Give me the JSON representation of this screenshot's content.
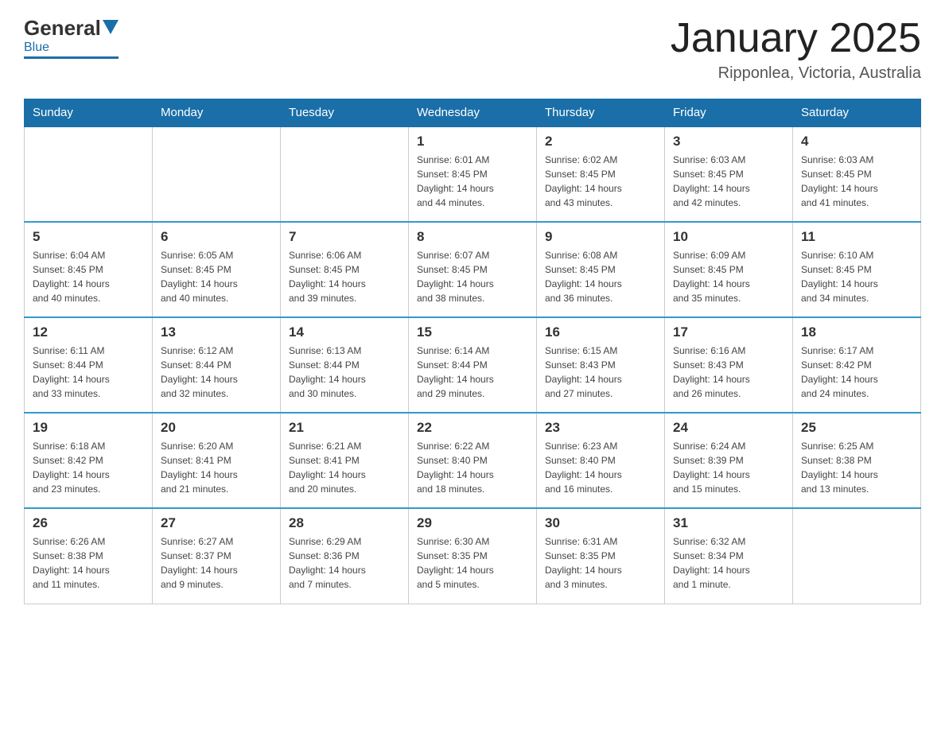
{
  "header": {
    "logo_text_general": "General",
    "logo_text_blue": "Blue",
    "calendar_title": "January 2025",
    "calendar_subtitle": "Ripponlea, Victoria, Australia"
  },
  "weekdays": [
    "Sunday",
    "Monday",
    "Tuesday",
    "Wednesday",
    "Thursday",
    "Friday",
    "Saturday"
  ],
  "weeks": [
    [
      {
        "day": "",
        "info": ""
      },
      {
        "day": "",
        "info": ""
      },
      {
        "day": "",
        "info": ""
      },
      {
        "day": "1",
        "info": "Sunrise: 6:01 AM\nSunset: 8:45 PM\nDaylight: 14 hours\nand 44 minutes."
      },
      {
        "day": "2",
        "info": "Sunrise: 6:02 AM\nSunset: 8:45 PM\nDaylight: 14 hours\nand 43 minutes."
      },
      {
        "day": "3",
        "info": "Sunrise: 6:03 AM\nSunset: 8:45 PM\nDaylight: 14 hours\nand 42 minutes."
      },
      {
        "day": "4",
        "info": "Sunrise: 6:03 AM\nSunset: 8:45 PM\nDaylight: 14 hours\nand 41 minutes."
      }
    ],
    [
      {
        "day": "5",
        "info": "Sunrise: 6:04 AM\nSunset: 8:45 PM\nDaylight: 14 hours\nand 40 minutes."
      },
      {
        "day": "6",
        "info": "Sunrise: 6:05 AM\nSunset: 8:45 PM\nDaylight: 14 hours\nand 40 minutes."
      },
      {
        "day": "7",
        "info": "Sunrise: 6:06 AM\nSunset: 8:45 PM\nDaylight: 14 hours\nand 39 minutes."
      },
      {
        "day": "8",
        "info": "Sunrise: 6:07 AM\nSunset: 8:45 PM\nDaylight: 14 hours\nand 38 minutes."
      },
      {
        "day": "9",
        "info": "Sunrise: 6:08 AM\nSunset: 8:45 PM\nDaylight: 14 hours\nand 36 minutes."
      },
      {
        "day": "10",
        "info": "Sunrise: 6:09 AM\nSunset: 8:45 PM\nDaylight: 14 hours\nand 35 minutes."
      },
      {
        "day": "11",
        "info": "Sunrise: 6:10 AM\nSunset: 8:45 PM\nDaylight: 14 hours\nand 34 minutes."
      }
    ],
    [
      {
        "day": "12",
        "info": "Sunrise: 6:11 AM\nSunset: 8:44 PM\nDaylight: 14 hours\nand 33 minutes."
      },
      {
        "day": "13",
        "info": "Sunrise: 6:12 AM\nSunset: 8:44 PM\nDaylight: 14 hours\nand 32 minutes."
      },
      {
        "day": "14",
        "info": "Sunrise: 6:13 AM\nSunset: 8:44 PM\nDaylight: 14 hours\nand 30 minutes."
      },
      {
        "day": "15",
        "info": "Sunrise: 6:14 AM\nSunset: 8:44 PM\nDaylight: 14 hours\nand 29 minutes."
      },
      {
        "day": "16",
        "info": "Sunrise: 6:15 AM\nSunset: 8:43 PM\nDaylight: 14 hours\nand 27 minutes."
      },
      {
        "day": "17",
        "info": "Sunrise: 6:16 AM\nSunset: 8:43 PM\nDaylight: 14 hours\nand 26 minutes."
      },
      {
        "day": "18",
        "info": "Sunrise: 6:17 AM\nSunset: 8:42 PM\nDaylight: 14 hours\nand 24 minutes."
      }
    ],
    [
      {
        "day": "19",
        "info": "Sunrise: 6:18 AM\nSunset: 8:42 PM\nDaylight: 14 hours\nand 23 minutes."
      },
      {
        "day": "20",
        "info": "Sunrise: 6:20 AM\nSunset: 8:41 PM\nDaylight: 14 hours\nand 21 minutes."
      },
      {
        "day": "21",
        "info": "Sunrise: 6:21 AM\nSunset: 8:41 PM\nDaylight: 14 hours\nand 20 minutes."
      },
      {
        "day": "22",
        "info": "Sunrise: 6:22 AM\nSunset: 8:40 PM\nDaylight: 14 hours\nand 18 minutes."
      },
      {
        "day": "23",
        "info": "Sunrise: 6:23 AM\nSunset: 8:40 PM\nDaylight: 14 hours\nand 16 minutes."
      },
      {
        "day": "24",
        "info": "Sunrise: 6:24 AM\nSunset: 8:39 PM\nDaylight: 14 hours\nand 15 minutes."
      },
      {
        "day": "25",
        "info": "Sunrise: 6:25 AM\nSunset: 8:38 PM\nDaylight: 14 hours\nand 13 minutes."
      }
    ],
    [
      {
        "day": "26",
        "info": "Sunrise: 6:26 AM\nSunset: 8:38 PM\nDaylight: 14 hours\nand 11 minutes."
      },
      {
        "day": "27",
        "info": "Sunrise: 6:27 AM\nSunset: 8:37 PM\nDaylight: 14 hours\nand 9 minutes."
      },
      {
        "day": "28",
        "info": "Sunrise: 6:29 AM\nSunset: 8:36 PM\nDaylight: 14 hours\nand 7 minutes."
      },
      {
        "day": "29",
        "info": "Sunrise: 6:30 AM\nSunset: 8:35 PM\nDaylight: 14 hours\nand 5 minutes."
      },
      {
        "day": "30",
        "info": "Sunrise: 6:31 AM\nSunset: 8:35 PM\nDaylight: 14 hours\nand 3 minutes."
      },
      {
        "day": "31",
        "info": "Sunrise: 6:32 AM\nSunset: 8:34 PM\nDaylight: 14 hours\nand 1 minute."
      },
      {
        "day": "",
        "info": ""
      }
    ]
  ]
}
